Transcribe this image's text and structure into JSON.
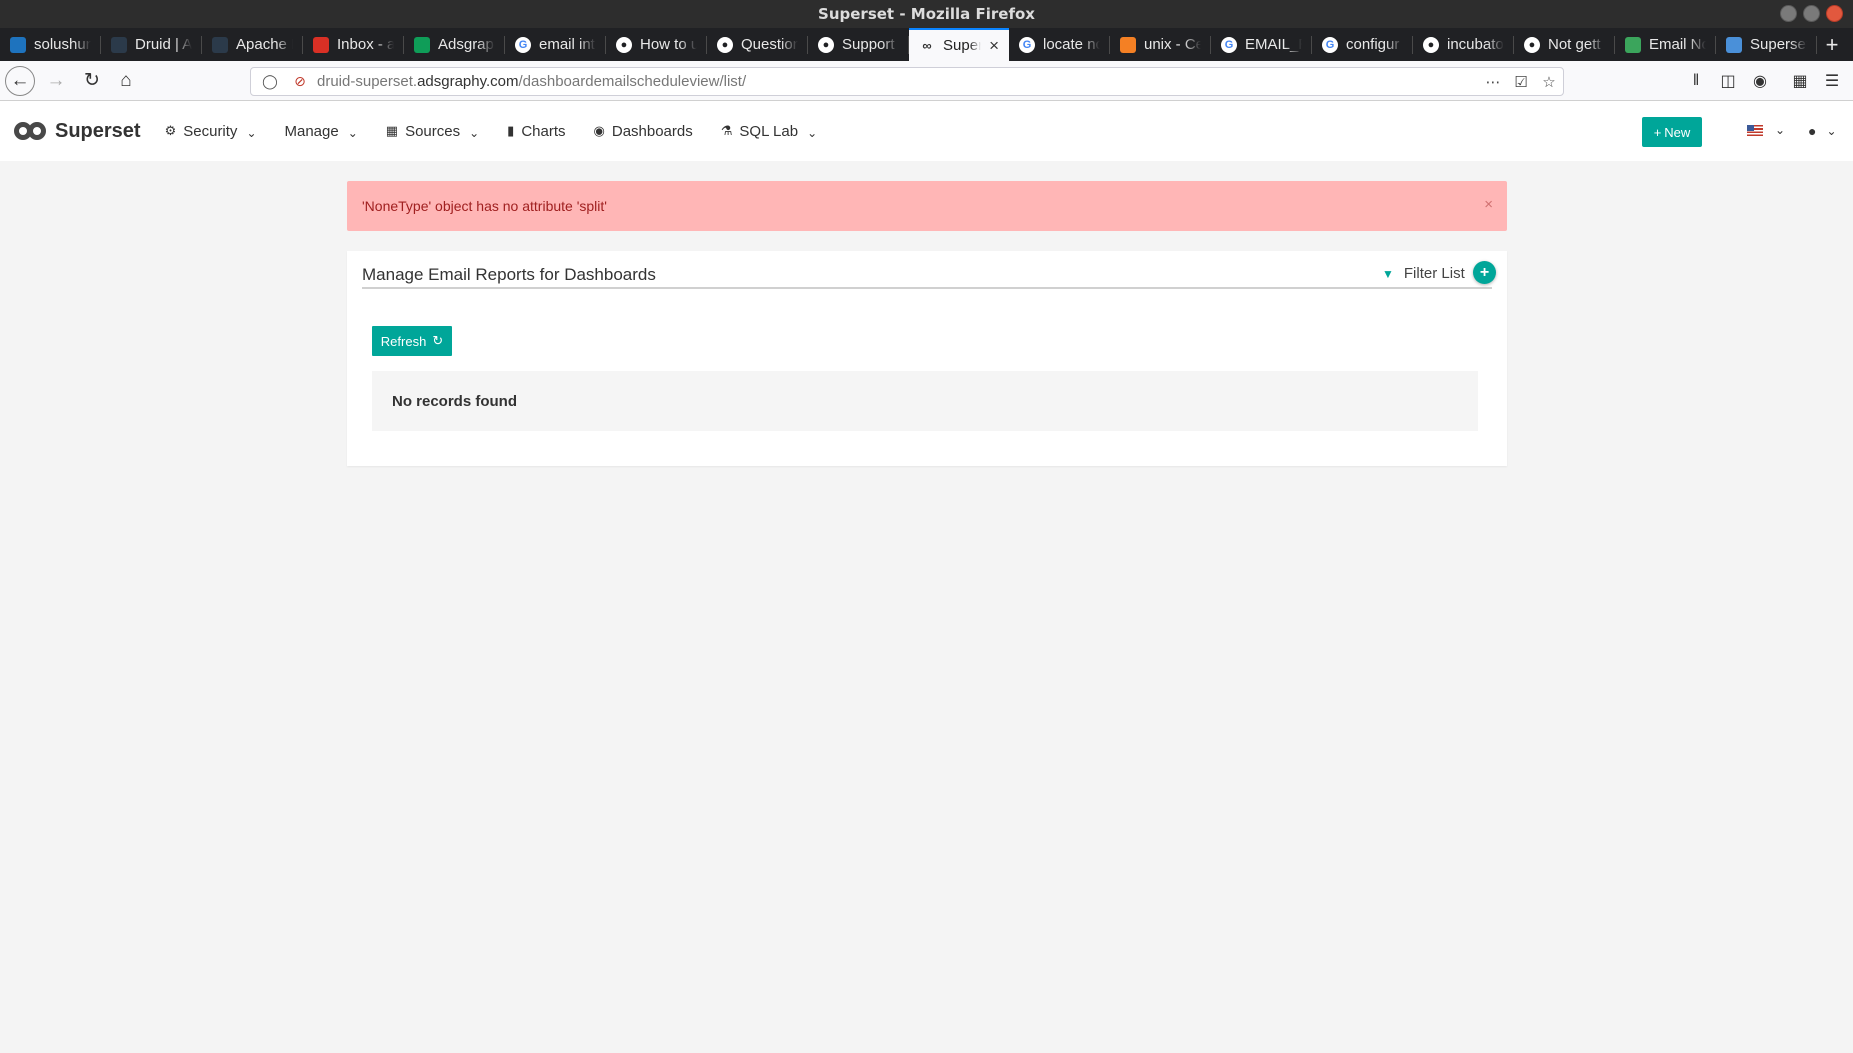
{
  "window": {
    "title": "Superset - Mozilla Firefox"
  },
  "tabs": [
    {
      "label": "solushun",
      "icon": "trello-icon",
      "color": "#1e73be"
    },
    {
      "label": "Druid | A",
      "icon": "druid-icon",
      "color": "#2b3a4a"
    },
    {
      "label": "Apache D",
      "icon": "druid-icon",
      "color": "#2b3a4a"
    },
    {
      "label": "Inbox - a",
      "icon": "gmail-icon",
      "color": "#d93025"
    },
    {
      "label": "Adsgrapl",
      "icon": "sheets-icon",
      "color": "#0f9d58"
    },
    {
      "label": "email int",
      "icon": "google-icon",
      "color": "#ffffff"
    },
    {
      "label": "How to u",
      "icon": "github-icon",
      "color": "#ffffff"
    },
    {
      "label": "Question",
      "icon": "github-icon",
      "color": "#ffffff"
    },
    {
      "label": "Support",
      "icon": "github-icon",
      "color": "#ffffff"
    },
    {
      "label": "Super",
      "icon": "superset-icon",
      "color": "#333333",
      "active": true
    },
    {
      "label": "locate nc",
      "icon": "google-icon",
      "color": "#ffffff"
    },
    {
      "label": "unix - Ce",
      "icon": "stackexchange-icon",
      "color": "#f48024"
    },
    {
      "label": "EMAIL_R",
      "icon": "google-icon",
      "color": "#ffffff"
    },
    {
      "label": "configur",
      "icon": "google-icon",
      "color": "#ffffff"
    },
    {
      "label": "incubato",
      "icon": "github-icon",
      "color": "#ffffff"
    },
    {
      "label": "Not gett",
      "icon": "github-icon",
      "color": "#ffffff"
    },
    {
      "label": "Email No",
      "icon": "cloud-icon",
      "color": "#3ba55c"
    },
    {
      "label": "Superset",
      "icon": "docs-icon",
      "color": "#4a90d9"
    }
  ],
  "urlbar": {
    "url_prefix": "druid-superset.",
    "url_domain": "adsgraphy.com",
    "url_path": "/dashboardemailscheduleview/list/"
  },
  "app": {
    "brand": "Superset",
    "menu": [
      {
        "label": "Security",
        "icon": "cogs-icon",
        "has_caret": true
      },
      {
        "label": "Manage",
        "icon": "",
        "has_caret": true
      },
      {
        "label": "Sources",
        "icon": "table-icon",
        "has_caret": true
      },
      {
        "label": "Charts",
        "icon": "bar-chart-icon",
        "has_caret": false
      },
      {
        "label": "Dashboards",
        "icon": "dashboard-icon",
        "has_caret": false
      },
      {
        "label": "SQL Lab",
        "icon": "flask-icon",
        "has_caret": true
      }
    ],
    "new_button": "New"
  },
  "alert": {
    "message": "'NoneType' object has no attribute 'split'"
  },
  "panel": {
    "title": "Manage Email Reports for Dashboards",
    "filter_label": "Filter List",
    "refresh_label": "Refresh",
    "empty_text": "No records found"
  },
  "colors": {
    "accent": "#00a699",
    "alert_bg": "#ffb6b6",
    "alert_text": "#a02020"
  }
}
